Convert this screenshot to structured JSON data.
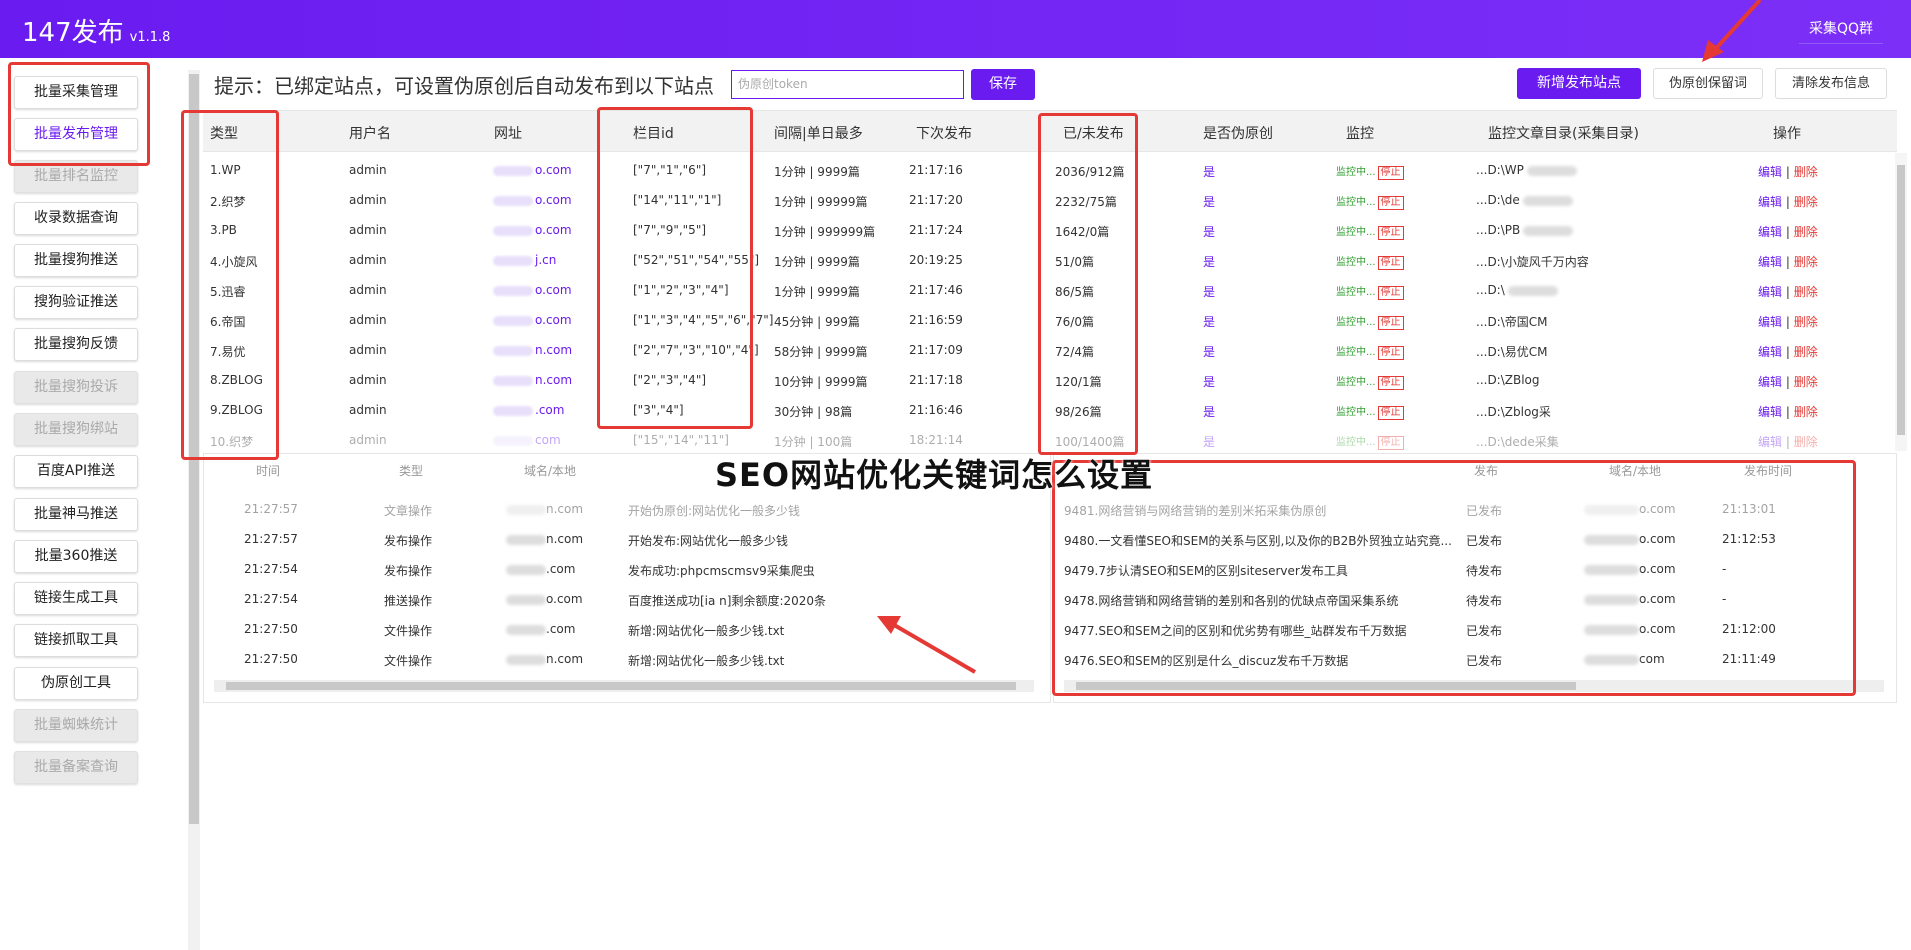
{
  "app": {
    "title": "147发布",
    "version": "v1.1.8",
    "qq_button": "采集QQ群"
  },
  "sidebar": {
    "items": [
      {
        "label": "批量采集管理",
        "state": "normal"
      },
      {
        "label": "批量发布管理",
        "state": "active"
      },
      {
        "label": "批量排名监控",
        "state": "disabled"
      },
      {
        "label": "收录数据查询",
        "state": "normal"
      },
      {
        "label": "批量搜狗推送",
        "state": "normal"
      },
      {
        "label": "搜狗验证推送",
        "state": "normal"
      },
      {
        "label": "批量搜狗反馈",
        "state": "normal"
      },
      {
        "label": "批量搜狗投诉",
        "state": "disabled"
      },
      {
        "label": "批量搜狗绑站",
        "state": "disabled"
      },
      {
        "label": "百度API推送",
        "state": "normal"
      },
      {
        "label": "批量神马推送",
        "state": "normal"
      },
      {
        "label": "批量360推送",
        "state": "normal"
      },
      {
        "label": "链接生成工具",
        "state": "normal"
      },
      {
        "label": "链接抓取工具",
        "state": "normal"
      },
      {
        "label": "伪原创工具",
        "state": "normal"
      },
      {
        "label": "批量蜘蛛统计",
        "state": "disabled"
      },
      {
        "label": "批量备案查询",
        "state": "disabled"
      }
    ]
  },
  "toolbar": {
    "hint": "提示：已绑定站点，可设置伪原创后自动发布到以下站点",
    "token_placeholder": "伪原创token",
    "save": "保存",
    "add_site": "新增发布站点",
    "pseudo_message": "伪原创保留词",
    "clear_info": "清除发布信息"
  },
  "sites_table": {
    "headers": [
      "类型",
      "用户名",
      "网址",
      "栏目id",
      "间隔|单日最多",
      "下次发布",
      "已/未发布",
      "是否伪原创",
      "监控",
      "监控文章目录(采集目录)",
      "操作"
    ],
    "rows": [
      {
        "type": "1.WP",
        "user": "admin",
        "url": "o.com",
        "cat": "[\"7\",\"1\",\"6\"]",
        "interval": "1分钟 | 9999篇",
        "next": "21:17:16",
        "count": "2036/912篇",
        "pseudo": "是",
        "monitor": "监控中...",
        "stop": "停止",
        "dir": "...D:\\WP",
        "edit": "编辑",
        "del": "删除"
      },
      {
        "type": "2.织梦",
        "user": "admin",
        "url": "o.com",
        "cat": "[\"14\",\"11\",\"1\"]",
        "interval": "1分钟 | 99999篇",
        "next": "21:17:20",
        "count": "2232/75篇",
        "pseudo": "是",
        "monitor": "监控中...",
        "stop": "停止",
        "dir": "...D:\\de",
        "edit": "编辑",
        "del": "删除"
      },
      {
        "type": "3.PB",
        "user": "admin",
        "url": "o.com",
        "cat": "[\"7\",\"9\",\"5\"]",
        "interval": "1分钟 | 999999篇",
        "next": "21:17:24",
        "count": "1642/0篇",
        "pseudo": "是",
        "monitor": "监控中...",
        "stop": "停止",
        "dir": "...D:\\PB",
        "edit": "编辑",
        "del": "删除"
      },
      {
        "type": "4.小旋风",
        "user": "admin",
        "url": "j.cn",
        "cat": "[\"52\",\"51\",\"54\",\"55\"]",
        "interval": "1分钟 | 9999篇",
        "next": "20:19:25",
        "count": "51/0篇",
        "pseudo": "是",
        "monitor": "监控中...",
        "stop": "停止",
        "dir": "...D:\\小旋风千万内容",
        "edit": "编辑",
        "del": "删除"
      },
      {
        "type": "5.迅睿",
        "user": "admin",
        "url": "o.com",
        "cat": "[\"1\",\"2\",\"3\",\"4\"]",
        "interval": "1分钟 | 9999篇",
        "next": "21:17:46",
        "count": "86/5篇",
        "pseudo": "是",
        "monitor": "监控中...",
        "stop": "停止",
        "dir": "...D:\\",
        "edit": "编辑",
        "del": "删除"
      },
      {
        "type": "6.帝国",
        "user": "admin",
        "url": "o.com",
        "cat": "[\"1\",\"3\",\"4\",\"5\",\"6\",\"7\"]",
        "interval": "45分钟 | 999篇",
        "next": "21:16:59",
        "count": "76/0篇",
        "pseudo": "是",
        "monitor": "监控中...",
        "stop": "停止",
        "dir": "...D:\\帝国CM",
        "edit": "编辑",
        "del": "删除"
      },
      {
        "type": "7.易优",
        "user": "admin",
        "url": "n.com",
        "cat": "[\"2\",\"7\",\"3\",\"10\",\"4\"]",
        "interval": "58分钟 | 9999篇",
        "next": "21:17:09",
        "count": "72/4篇",
        "pseudo": "是",
        "monitor": "监控中...",
        "stop": "停止",
        "dir": "...D:\\易优CM",
        "edit": "编辑",
        "del": "删除"
      },
      {
        "type": "8.ZBLOG",
        "user": "admin",
        "url": "n.com",
        "cat": "[\"2\",\"3\",\"4\"]",
        "interval": "10分钟 | 9999篇",
        "next": "21:17:18",
        "count": "120/1篇",
        "pseudo": "是",
        "monitor": "监控中...",
        "stop": "停止",
        "dir": "...D:\\ZBlog",
        "edit": "编辑",
        "del": "删除"
      },
      {
        "type": "9.ZBLOG",
        "user": "admin",
        "url": ".com",
        "cat": "[\"3\",\"4\"]",
        "interval": "30分钟 | 98篇",
        "next": "21:16:46",
        "count": "98/26篇",
        "pseudo": "是",
        "monitor": "监控中...",
        "stop": "停止",
        "dir": "...D:\\Zblog采",
        "edit": "编辑",
        "del": "删除"
      },
      {
        "type": "10.织梦",
        "user": "admin",
        "url": "com",
        "cat": "[\"15\",\"14\",\"11\"]",
        "interval": "1分钟 | 100篇",
        "next": "18:21:14",
        "count": "100/1400篇",
        "pseudo": "是",
        "monitor": "监控中...",
        "stop": "停止",
        "dir": "...D:\\dede采集",
        "edit": "编辑",
        "del": "删除"
      }
    ]
  },
  "log_panel": {
    "headers": [
      "时间",
      "类型",
      "域名/本地"
    ],
    "rows": [
      {
        "time": "21:27:57",
        "type": "文章操作",
        "domain": "n.com",
        "msg": "开始伪原创:网站优化一般多少钱",
        "faded": true
      },
      {
        "time": "21:27:57",
        "type": "发布操作",
        "domain": "n.com",
        "msg": "开始发布:网站优化一般多少钱",
        "faded": false
      },
      {
        "time": "21:27:54",
        "type": "发布操作",
        "domain": ".com",
        "msg": "发布成功:phpcmscmsv9采集爬虫",
        "faded": false
      },
      {
        "time": "21:27:54",
        "type": "推送操作",
        "domain": "o.com",
        "msg": "百度推送成功[ia              n]剩余额度:2020条",
        "faded": false
      },
      {
        "time": "21:27:50",
        "type": "文件操作",
        "domain": ".com",
        "msg": "新增:网站优化一般多少钱.txt",
        "faded": false
      },
      {
        "time": "21:27:50",
        "type": "文件操作",
        "domain": "n.com",
        "msg": "新增:网站优化一般多少钱.txt",
        "faded": false
      }
    ]
  },
  "publish_panel": {
    "headers": [
      "发布",
      "域名/本地",
      "发布时间"
    ],
    "rows": [
      {
        "title": "9481.网络营销与网络营销的差别米拓采集伪原创",
        "status": "已发布",
        "domain": "o.com",
        "time": "21:13:01",
        "faded": true
      },
      {
        "title": "9480.一文看懂SEO和SEM的关系与区别,以及你的B2B外贸独立站究竟...",
        "status": "已发布",
        "domain": "o.com",
        "time": "21:12:53",
        "faded": false
      },
      {
        "title": "9479.7步认清SEO和SEM的区别siteserver发布工具",
        "status": "待发布",
        "domain": "o.com",
        "time": "-",
        "faded": false
      },
      {
        "title": "9478.网络营销和网络营销的差别和各别的优缺点帝国采集系统",
        "status": "待发布",
        "domain": "o.com",
        "time": "-",
        "faded": false
      },
      {
        "title": "9477.SEO和SEM之间的区别和优劣势有哪些_站群发布千万数据",
        "status": "已发布",
        "domain": "o.com",
        "time": "21:12:00",
        "faded": false
      },
      {
        "title": "9476.SEO和SEM的区别是什么_discuz发布千万数据",
        "status": "已发布",
        "domain": "com",
        "time": "21:11:49",
        "faded": false
      }
    ]
  },
  "overlay": {
    "title": "SEO网站优化关键词怎么设置"
  },
  "colors": {
    "brand": "#6a1bf0",
    "highlight": "#e53935",
    "monitor": "#2e9e2e"
  }
}
